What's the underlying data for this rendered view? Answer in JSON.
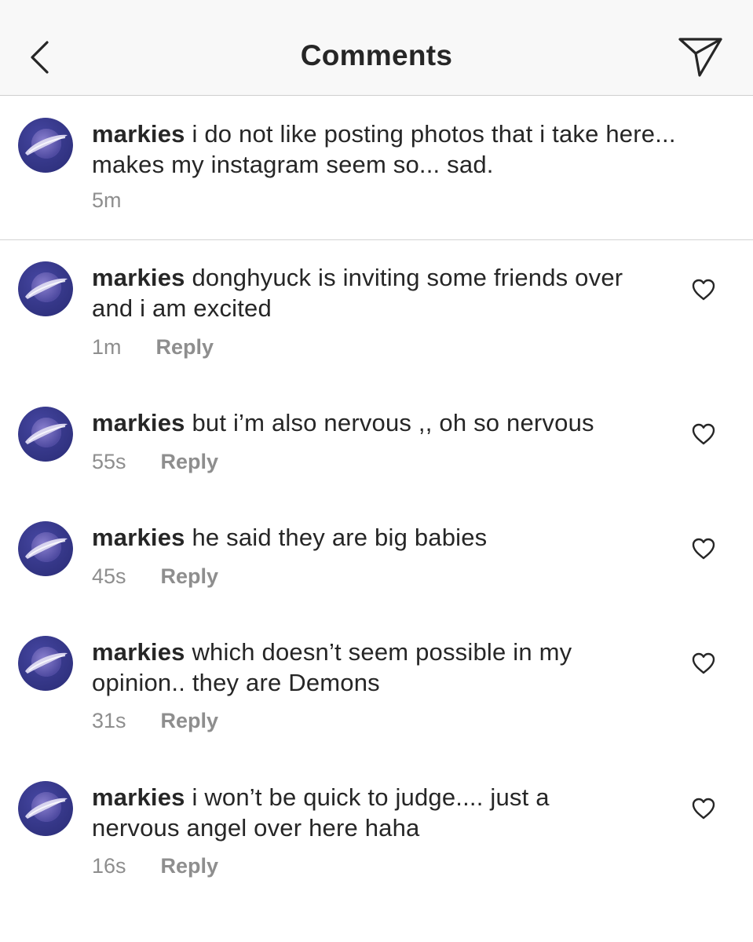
{
  "header": {
    "title": "Comments"
  },
  "caption": {
    "username": "markies",
    "text": "i do not like posting photos that i take here... makes my instagram seem so... sad.",
    "time": "5m"
  },
  "comments": [
    {
      "username": "markies",
      "text": "donghyuck is inviting some friends over and i am excited",
      "time": "1m",
      "reply_label": "Reply"
    },
    {
      "username": "markies",
      "text": "but i’m also nervous ,, oh so nervous",
      "time": "55s",
      "reply_label": "Reply"
    },
    {
      "username": "markies",
      "text": "he said they are big babies",
      "time": "45s",
      "reply_label": "Reply"
    },
    {
      "username": "markies",
      "text": "which doesn’t seem possible in my opinion.. they are Demons",
      "time": "31s",
      "reply_label": "Reply"
    },
    {
      "username": "markies",
      "text": "i won’t be quick to judge.... just a nervous angel over here haha",
      "time": "16s",
      "reply_label": "Reply"
    }
  ],
  "icons": {
    "back": "chevron-left-icon",
    "send": "paper-plane-icon",
    "like": "heart-outline-icon"
  },
  "colors": {
    "text": "#262626",
    "muted": "#8e8e8e",
    "header_bg": "#f8f8f8",
    "avatar_bg": "#3c3f95"
  }
}
